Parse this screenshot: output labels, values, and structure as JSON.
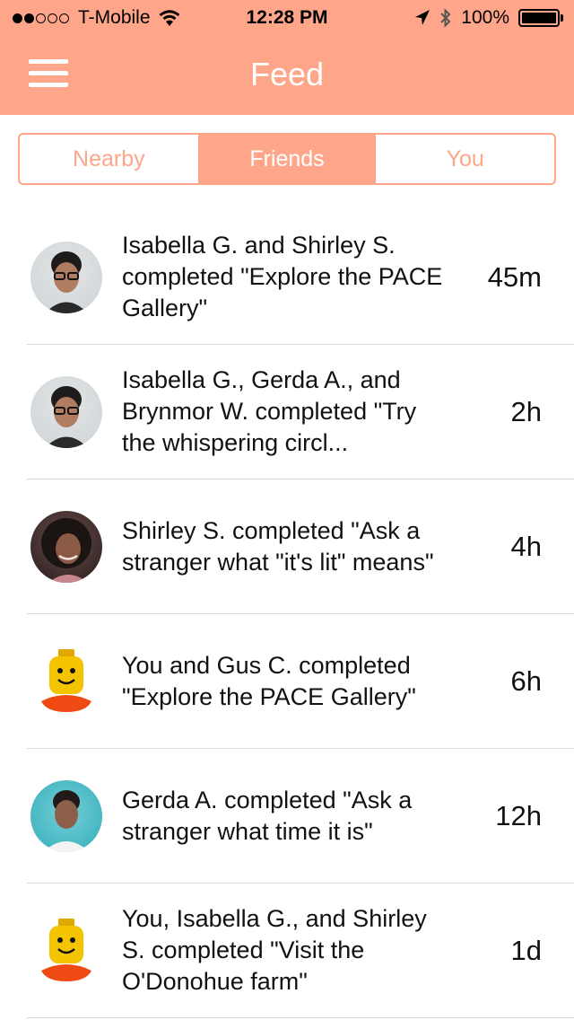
{
  "status_bar": {
    "carrier": "T-Mobile",
    "time": "12:28 PM",
    "battery": "100%",
    "signal_filled": 2,
    "signal_total": 5
  },
  "header": {
    "title": "Feed",
    "color": "#ffa68a"
  },
  "tabs": [
    {
      "label": "Nearby",
      "active": false
    },
    {
      "label": "Friends",
      "active": true
    },
    {
      "label": "You",
      "active": false
    }
  ],
  "feed": [
    {
      "avatar": "glasses-woman-avatar",
      "text": "Isabella G. and Shirley S. completed \"Explore the PACE Gallery\"",
      "time": "45m"
    },
    {
      "avatar": "glasses-woman-avatar",
      "text": "Isabella G., Gerda A., and Brynmor W. completed \"Try the whispering circl...",
      "time": "2h"
    },
    {
      "avatar": "curly-hair-woman-avatar",
      "text": "Shirley S. completed \"Ask a stranger what \"it's lit\" means\"",
      "time": "4h"
    },
    {
      "avatar": "lego-head-avatar",
      "text": "You and Gus C. completed \"Explore the PACE Gallery\"",
      "time": "6h"
    },
    {
      "avatar": "woman-teal-background-avatar",
      "text": "Gerda A. completed \"Ask a stranger what time it is\"",
      "time": "12h"
    },
    {
      "avatar": "lego-head-avatar",
      "text": "You, Isabella G., and Shirley S. completed \"Visit the O'Donohue farm\"",
      "time": "1d"
    }
  ]
}
